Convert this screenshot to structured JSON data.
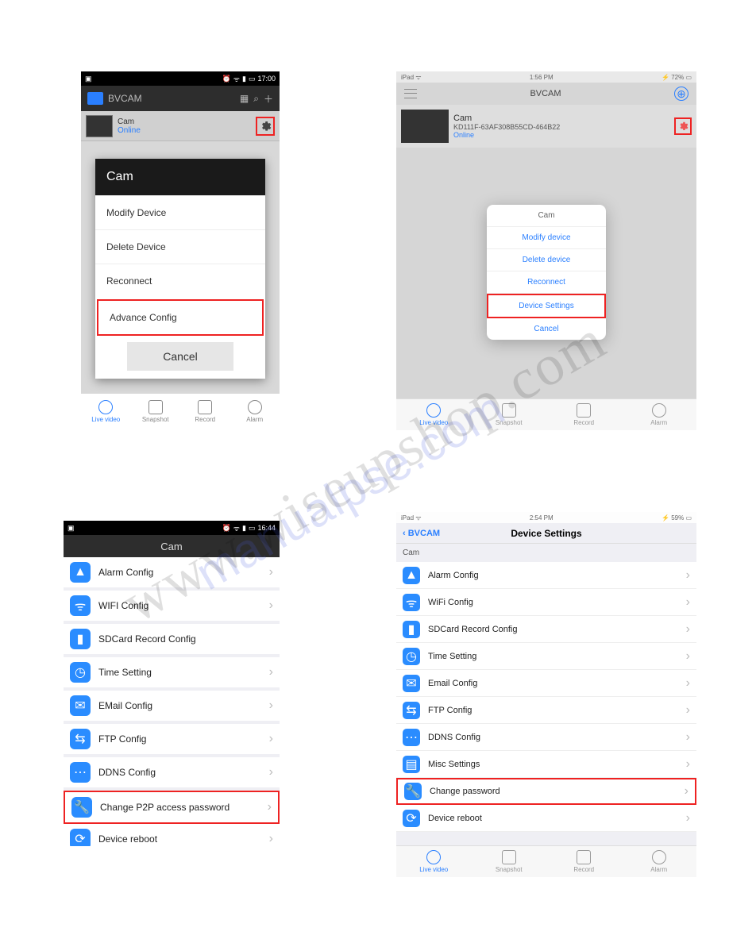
{
  "watermarks": {
    "main": "www.wiseupshop.com",
    "secondary": "manualpse.com"
  },
  "android_main": {
    "status_time": "17:00",
    "app_title": "BVCAM",
    "cam_name": "Cam",
    "cam_status": "Online",
    "popup": {
      "title": "Cam",
      "modify": "Modify Device",
      "delete": "Delete Device",
      "reconnect": "Reconnect",
      "advance": "Advance Config",
      "cancel": "Cancel"
    },
    "tabs": {
      "live": "Live video",
      "snap": "Snapshot",
      "rec": "Record",
      "alarm": "Alarm"
    }
  },
  "ipad_main": {
    "status_left": "iPad",
    "status_time": "1:56 PM",
    "status_right": "72%",
    "app_title": "BVCAM",
    "cam_name": "Cam",
    "cam_id": "KD111F-63AF308B55CD-464B22",
    "cam_status": "Online",
    "sheet": {
      "title": "Cam",
      "modify": "Modify device",
      "delete": "Delete device",
      "reconnect": "Reconnect",
      "settings": "Device Settings",
      "cancel": "Cancel"
    },
    "tabs": {
      "live": "Live video",
      "snap": "Snapshot",
      "rec": "Record",
      "alarm": "Alarm"
    }
  },
  "android_settings": {
    "status_time": "16:44",
    "title": "Cam",
    "rows": {
      "alarm": "Alarm Config",
      "wifi": "WIFI Config",
      "sd": "SDCard Record Config",
      "time": "Time Setting",
      "email": "EMail Config",
      "ftp": "FTP Config",
      "ddns": "DDNS Config",
      "pwd": "Change P2P access password",
      "reboot": "Device reboot"
    }
  },
  "ipad_settings": {
    "status_left": "iPad",
    "status_time": "2:54 PM",
    "status_right": "59%",
    "back": "BVCAM",
    "title": "Device Settings",
    "section": "Cam",
    "rows": {
      "alarm": "Alarm Config",
      "wifi": "WiFi Config",
      "sd": "SDCard Record Config",
      "time": "Time Setting",
      "email": "Email Config",
      "ftp": "FTP Config",
      "ddns": "DDNS Config",
      "misc": "Misc Settings",
      "pwd": "Change password",
      "reboot": "Device reboot"
    },
    "tabs": {
      "live": "Live video",
      "snap": "Snapshot",
      "rec": "Record",
      "alarm": "Alarm"
    }
  }
}
